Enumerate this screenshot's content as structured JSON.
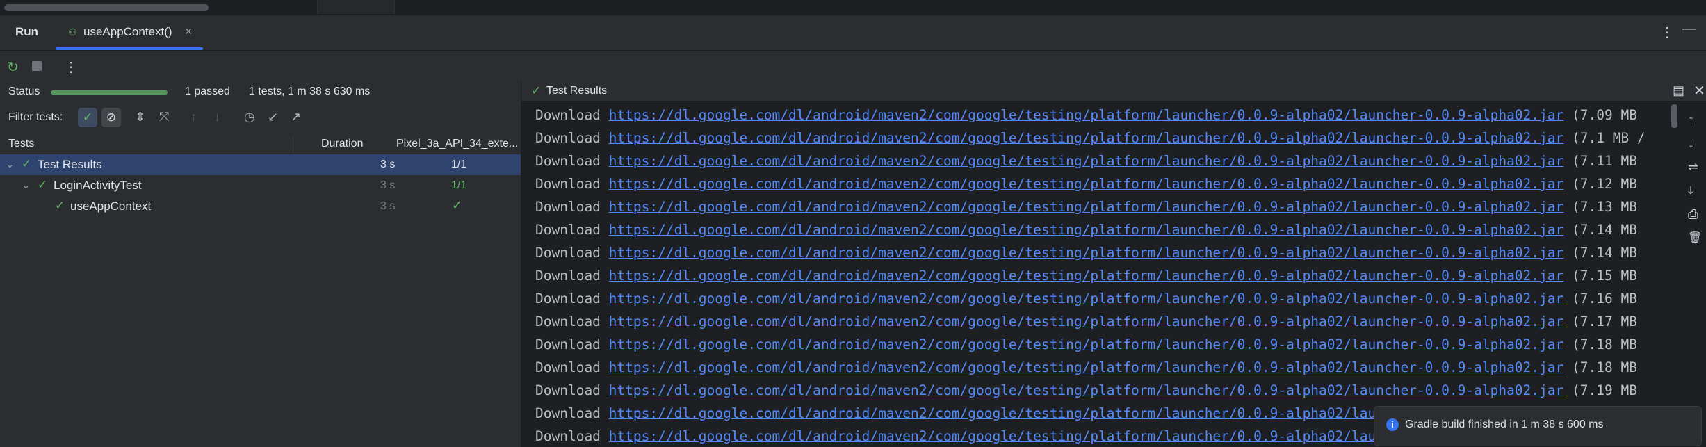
{
  "header": {
    "run_label": "Run",
    "tab_label": "useAppContext()",
    "tab_icon": "android-test-icon",
    "close_glyph": "×",
    "more_glyph": "⋮",
    "minimize_glyph": "—"
  },
  "toolbar": {
    "rerun_glyph": "↻",
    "more_glyph": "⋮"
  },
  "status": {
    "label": "Status",
    "progress": 1.0,
    "passed": "1 passed",
    "summary": "1 tests, 1 m 38 s 630 ms"
  },
  "filter": {
    "label": "Filter tests:",
    "passed_glyph": "✓",
    "ignored_glyph": "⊘"
  },
  "filter_tools": [
    "⇕",
    "⤧",
    "↑",
    "↓",
    "◷",
    "↙",
    "↗"
  ],
  "columns": {
    "tests": "Tests",
    "duration": "Duration",
    "device": "Pixel_3a_API_34_exte..."
  },
  "tree": [
    {
      "label": "Test Results",
      "duration": "3 s",
      "result": "1/1"
    },
    {
      "label": "LoginActivityTest",
      "duration": "3 s",
      "result": "1/1"
    },
    {
      "label": "useAppContext",
      "duration": "3 s",
      "result": "✓"
    }
  ],
  "results": {
    "title": "Test Results",
    "check_glyph": "✓",
    "layout_glyph": "▤",
    "close_glyph": "✕"
  },
  "console": {
    "prefix": "Download",
    "lines": [
      {
        "url": "https://dl.google.com/dl/android/maven2/com/google/testing/platform/launcher/0.0.9-alpha02/launcher-0.0.9-alpha02.jar",
        "tail": "(7.09 MB"
      },
      {
        "url": "https://dl.google.com/dl/android/maven2/com/google/testing/platform/launcher/0.0.9-alpha02/launcher-0.0.9-alpha02.jar",
        "tail": "(7.1 MB /"
      },
      {
        "url": "https://dl.google.com/dl/android/maven2/com/google/testing/platform/launcher/0.0.9-alpha02/launcher-0.0.9-alpha02.jar",
        "tail": "(7.11 MB"
      },
      {
        "url": "https://dl.google.com/dl/android/maven2/com/google/testing/platform/launcher/0.0.9-alpha02/launcher-0.0.9-alpha02.jar",
        "tail": "(7.12 MB"
      },
      {
        "url": "https://dl.google.com/dl/android/maven2/com/google/testing/platform/launcher/0.0.9-alpha02/launcher-0.0.9-alpha02.jar",
        "tail": "(7.13 MB"
      },
      {
        "url": "https://dl.google.com/dl/android/maven2/com/google/testing/platform/launcher/0.0.9-alpha02/launcher-0.0.9-alpha02.jar",
        "tail": "(7.14 MB"
      },
      {
        "url": "https://dl.google.com/dl/android/maven2/com/google/testing/platform/launcher/0.0.9-alpha02/launcher-0.0.9-alpha02.jar",
        "tail": "(7.14 MB"
      },
      {
        "url": "https://dl.google.com/dl/android/maven2/com/google/testing/platform/launcher/0.0.9-alpha02/launcher-0.0.9-alpha02.jar",
        "tail": "(7.15 MB"
      },
      {
        "url": "https://dl.google.com/dl/android/maven2/com/google/testing/platform/launcher/0.0.9-alpha02/launcher-0.0.9-alpha02.jar",
        "tail": "(7.16 MB"
      },
      {
        "url": "https://dl.google.com/dl/android/maven2/com/google/testing/platform/launcher/0.0.9-alpha02/launcher-0.0.9-alpha02.jar",
        "tail": "(7.17 MB"
      },
      {
        "url": "https://dl.google.com/dl/android/maven2/com/google/testing/platform/launcher/0.0.9-alpha02/launcher-0.0.9-alpha02.jar",
        "tail": "(7.18 MB"
      },
      {
        "url": "https://dl.google.com/dl/android/maven2/com/google/testing/platform/launcher/0.0.9-alpha02/launcher-0.0.9-alpha02.jar",
        "tail": "(7.18 MB"
      },
      {
        "url": "https://dl.google.com/dl/android/maven2/com/google/testing/platform/launcher/0.0.9-alpha02/launcher-0.0.9-alpha02.jar",
        "tail": "(7.19 MB"
      },
      {
        "url": "https://dl.google.com/dl/android/maven2/com/google/testing/platform/launcher/0.0.9-alpha02/launcher-0.0.9-alpha02.jar",
        "tail": ""
      },
      {
        "url": "https://dl.google.com/dl/android/maven2/com/google/testing/platform/launcher/0.0.9-alpha02/launcher-0.0.9-alpha02.jar",
        "tail": ""
      }
    ]
  },
  "console_tools": [
    "↑",
    "↓",
    "⇌",
    "⤓",
    "⎙",
    "🗑"
  ],
  "notification": {
    "icon": "i",
    "text": "Gradle build finished in 1 m 38 s 600 ms"
  },
  "colors": {
    "accent": "#3574f0",
    "pass": "#5fb865",
    "link": "#548af7",
    "selection": "#2e436e"
  }
}
